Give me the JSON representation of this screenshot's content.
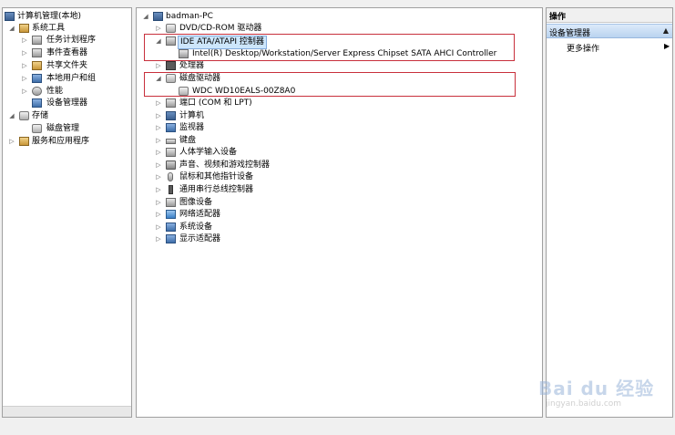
{
  "left_tree": {
    "root": "计算机管理(本地)",
    "system_tools": "系统工具",
    "task_scheduler": "任务计划程序",
    "event_viewer": "事件查看器",
    "shared_folders": "共享文件夹",
    "local_users": "本地用户和组",
    "performance": "性能",
    "device_manager": "设备管理器",
    "storage": "存储",
    "disk_management": "磁盘管理",
    "services_apps": "服务和应用程序"
  },
  "device_tree": {
    "computer": "badman-PC",
    "dvd": "DVD/CD-ROM 驱动器",
    "ide": "IDE ATA/ATAPI 控制器",
    "ide_child": "Intel(R) Desktop/Workstation/Server Express Chipset SATA AHCI Controller",
    "processor": "处理器",
    "disk_drives": "磁盘驱动器",
    "disk_child": "WDC WD10EALS-00Z8A0",
    "ports": "端口 (COM 和 LPT)",
    "computer_node": "计算机",
    "monitors": "监视器",
    "keyboard": "键盘",
    "hid": "人体学输入设备",
    "sound": "声音、视频和游戏控制器",
    "mice": "鼠标和其他指针设备",
    "usb": "通用串行总线控制器",
    "imaging": "图像设备",
    "network": "网络适配器",
    "system_devices": "系统设备",
    "display": "显示适配器"
  },
  "actions": {
    "header": "操作",
    "section": "设备管理器",
    "more": "更多操作"
  },
  "watermark": {
    "brand": "Bai du 经验",
    "url": "jingyan.baidu.com"
  }
}
